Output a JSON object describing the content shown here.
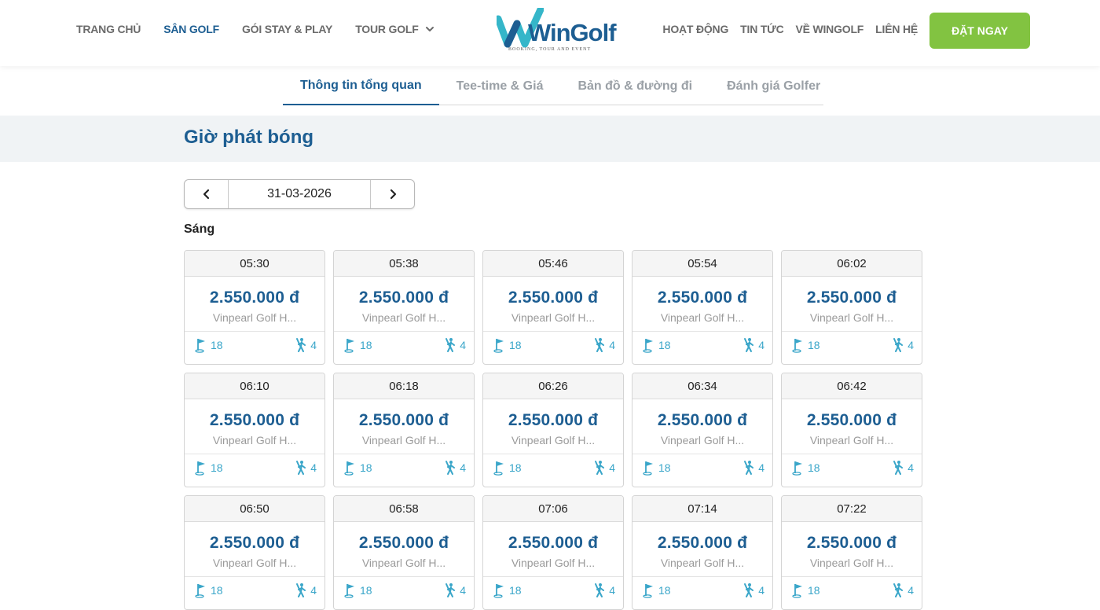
{
  "header": {
    "nav_left": [
      {
        "label": "TRANG CHỦ",
        "active": false
      },
      {
        "label": "SÂN GOLF",
        "active": true
      },
      {
        "label": "GÓI STAY & PLAY",
        "active": false
      },
      {
        "label": "TOUR GOLF",
        "active": false,
        "has_dropdown": true
      }
    ],
    "nav_right": [
      {
        "label": "HOẠT ĐỘNG"
      },
      {
        "label": "TIN TỨC"
      },
      {
        "label": "VỀ WINGOLF"
      },
      {
        "label": "LIÊN HỆ"
      }
    ],
    "logo": {
      "text": "WinGolf",
      "tagline": "BOOKING, TOUR AND EVENT"
    },
    "cta_label": "ĐẶT NGAY",
    "colors": {
      "brand": "#1d5e92",
      "cta": "#82c341",
      "accent": "#3aa6c9"
    }
  },
  "tabs": [
    {
      "label": "Thông tin tổng quan",
      "active": true
    },
    {
      "label": "Tee-time & Giá",
      "active": false
    },
    {
      "label": "Bản đồ & đường đi",
      "active": false
    },
    {
      "label": "Đánh giá Golfer",
      "active": false
    }
  ],
  "section": {
    "title": "Giờ phát bóng"
  },
  "date_picker": {
    "value": "31-03-2026",
    "prev_icon": "chevron-left-icon",
    "next_icon": "chevron-right-icon"
  },
  "session_label": "Sáng",
  "tee_times": [
    {
      "time": "05:30",
      "price": "2.550.000 đ",
      "course": "Vinpearl Golf H...",
      "holes": "18",
      "players": "4"
    },
    {
      "time": "05:38",
      "price": "2.550.000 đ",
      "course": "Vinpearl Golf H...",
      "holes": "18",
      "players": "4"
    },
    {
      "time": "05:46",
      "price": "2.550.000 đ",
      "course": "Vinpearl Golf H...",
      "holes": "18",
      "players": "4"
    },
    {
      "time": "05:54",
      "price": "2.550.000 đ",
      "course": "Vinpearl Golf H...",
      "holes": "18",
      "players": "4"
    },
    {
      "time": "06:02",
      "price": "2.550.000 đ",
      "course": "Vinpearl Golf H...",
      "holes": "18",
      "players": "4"
    },
    {
      "time": "06:10",
      "price": "2.550.000 đ",
      "course": "Vinpearl Golf H...",
      "holes": "18",
      "players": "4"
    },
    {
      "time": "06:18",
      "price": "2.550.000 đ",
      "course": "Vinpearl Golf H...",
      "holes": "18",
      "players": "4"
    },
    {
      "time": "06:26",
      "price": "2.550.000 đ",
      "course": "Vinpearl Golf H...",
      "holes": "18",
      "players": "4"
    },
    {
      "time": "06:34",
      "price": "2.550.000 đ",
      "course": "Vinpearl Golf H...",
      "holes": "18",
      "players": "4"
    },
    {
      "time": "06:42",
      "price": "2.550.000 đ",
      "course": "Vinpearl Golf H...",
      "holes": "18",
      "players": "4"
    },
    {
      "time": "06:50",
      "price": "2.550.000 đ",
      "course": "Vinpearl Golf H...",
      "holes": "18",
      "players": "4"
    },
    {
      "time": "06:58",
      "price": "2.550.000 đ",
      "course": "Vinpearl Golf H...",
      "holes": "18",
      "players": "4"
    },
    {
      "time": "07:06",
      "price": "2.550.000 đ",
      "course": "Vinpearl Golf H...",
      "holes": "18",
      "players": "4"
    },
    {
      "time": "07:14",
      "price": "2.550.000 đ",
      "course": "Vinpearl Golf H...",
      "holes": "18",
      "players": "4"
    },
    {
      "time": "07:22",
      "price": "2.550.000 đ",
      "course": "Vinpearl Golf H...",
      "holes": "18",
      "players": "4"
    }
  ]
}
